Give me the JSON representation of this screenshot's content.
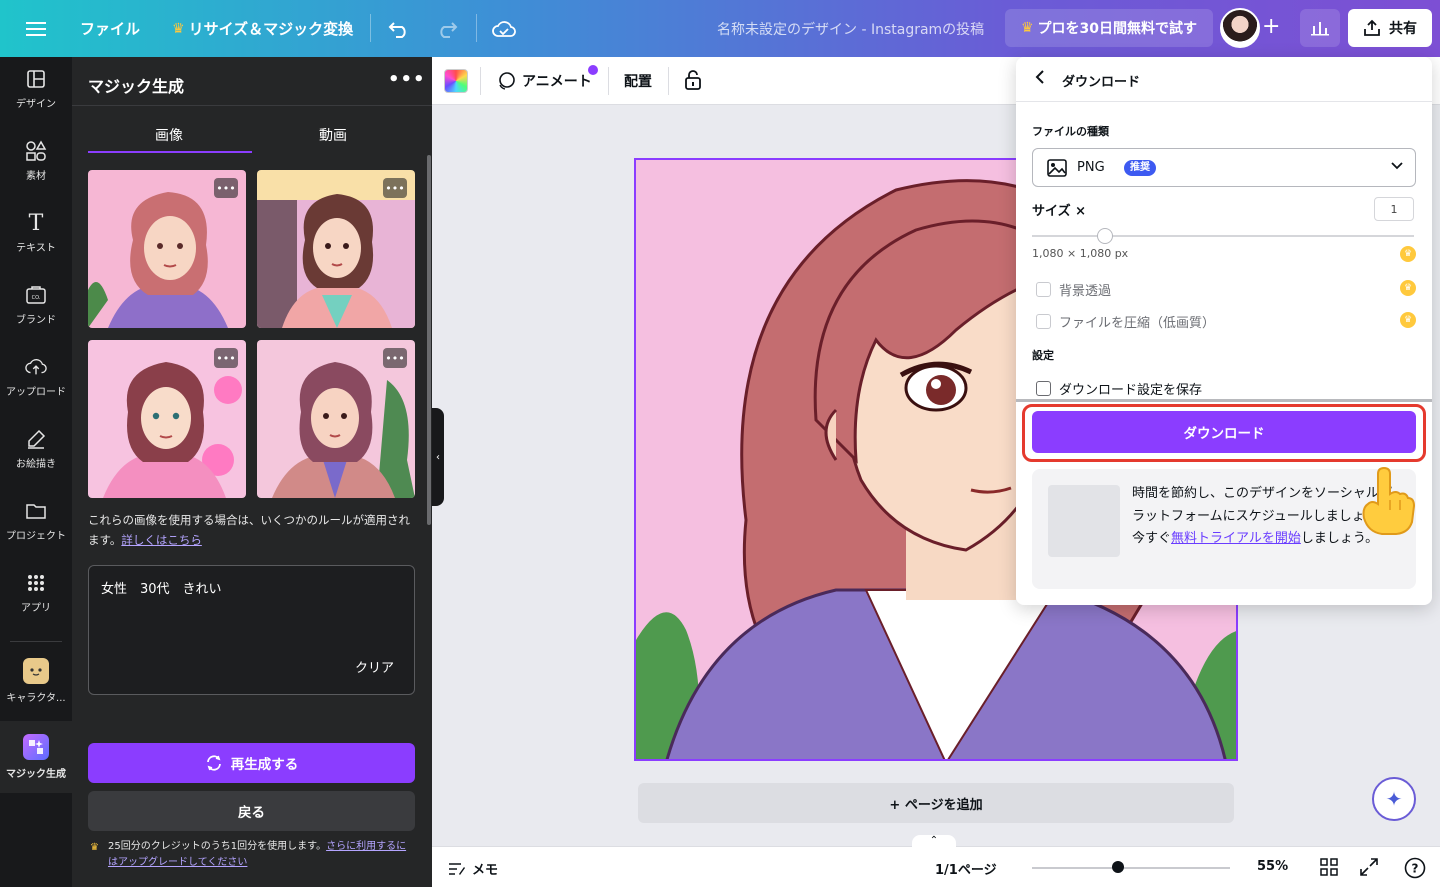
{
  "topbar": {
    "file_label": "ファイル",
    "resize_label": "リサイズ＆マジック変換",
    "doc_title": "名称未設定のデザイン - Instagramの投稿",
    "pro_trial_label": "プロを30日間無料で試す",
    "share_label": "共有",
    "accent_gradient": [
      "#20c4cb",
      "#7d4fd4"
    ]
  },
  "rail": {
    "items": [
      {
        "label": "デザイン",
        "icon": "layout-icon"
      },
      {
        "label": "素材",
        "icon": "shapes-icon"
      },
      {
        "label": "テキスト",
        "icon": "text-icon"
      },
      {
        "label": "ブランド",
        "icon": "brand-icon"
      },
      {
        "label": "アップロード",
        "icon": "cloud-upload-icon"
      },
      {
        "label": "お絵描き",
        "icon": "draw-icon"
      },
      {
        "label": "プロジェクト",
        "icon": "folder-icon"
      },
      {
        "label": "アプリ",
        "icon": "apps-grid-icon"
      },
      {
        "label": "キャラクタ...",
        "icon": "character-app-icon"
      },
      {
        "label": "マジック生成",
        "icon": "magic-media-icon"
      }
    ]
  },
  "panel": {
    "title": "マジック生成",
    "tabs": [
      "画像",
      "動画"
    ],
    "active_tab": "画像",
    "note_text": "これらの画像を使用する場合は、いくつかのルールが適用されます。",
    "note_link": "詳しくはこちら",
    "prompt_text": "女性　30代　きれい",
    "clear_label": "クリア",
    "regenerate_label": "再生成する",
    "back_label": "戻る",
    "credit_text": "25回分のクレジットのうち1回分を使用します。",
    "credit_link": "さらに利用するにはアップグレードしてください"
  },
  "toolbar": {
    "animate_label": "アニメート",
    "arrange_label": "配置"
  },
  "canvas": {
    "add_page_label": "+ ページを追加"
  },
  "bottombar": {
    "notes_label": "メモ",
    "page_indicator": "1/1ページ",
    "zoom_label": "55%"
  },
  "download": {
    "title": "ダウンロード",
    "file_type_label": "ファイルの種類",
    "file_type_value": "PNG",
    "recommended_badge": "推奨",
    "size_label": "サイズ ×",
    "size_value": "1",
    "dimensions": "1,080 × 1,080 px",
    "transparent_bg_label": "背景透過",
    "compress_label": "ファイルを圧縮（低画質）",
    "settings_label": "設定",
    "save_settings_label": "ダウンロード設定を保存",
    "download_button_label": "ダウンロード",
    "promo_text": "時間を節約し、このデザインをソーシャルプラットフォームにスケジュールしましょう。今すぐ",
    "promo_link": "無料トライアルを開始",
    "promo_tail": "しましょう。",
    "highlight_color": "#e53a2e",
    "primary_color": "#8b3dff"
  }
}
